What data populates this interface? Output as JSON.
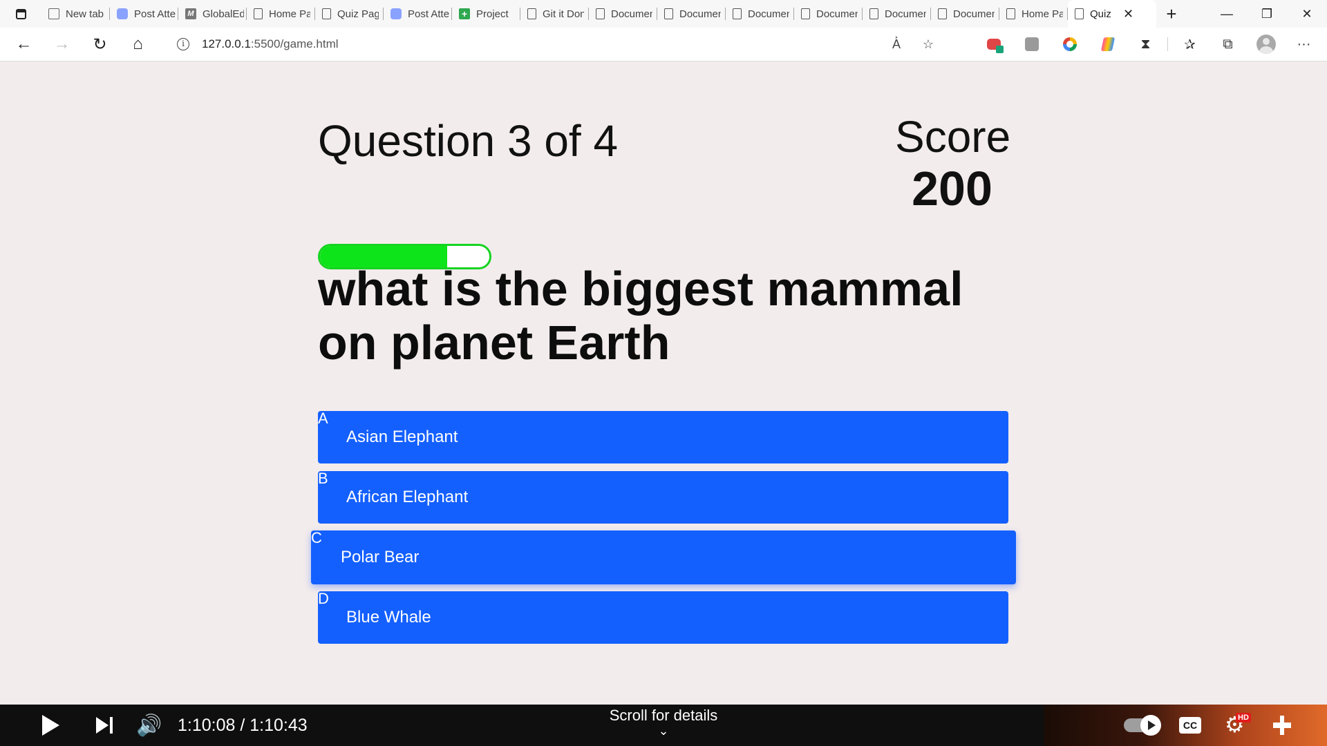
{
  "browser": {
    "tabs": [
      {
        "label": "New tab",
        "icon": "newtab-icon"
      },
      {
        "label": "Post Attendee",
        "icon": "zoom-icon"
      },
      {
        "label": "GlobalEd",
        "icon": "m-icon"
      },
      {
        "label": "Home Page",
        "icon": "doc-icon"
      },
      {
        "label": "Quiz Page",
        "icon": "doc-icon"
      },
      {
        "label": "Post Attendee",
        "icon": "zoom-icon"
      },
      {
        "label": "Project",
        "icon": "plus-icon"
      },
      {
        "label": "Git it Done",
        "icon": "doc-icon"
      },
      {
        "label": "Document",
        "icon": "doc-icon"
      },
      {
        "label": "Document",
        "icon": "doc-icon"
      },
      {
        "label": "Document",
        "icon": "doc-icon"
      },
      {
        "label": "Document",
        "icon": "doc-icon"
      },
      {
        "label": "Document",
        "icon": "doc-icon"
      },
      {
        "label": "Document",
        "icon": "doc-icon"
      },
      {
        "label": "Home Page",
        "icon": "doc-icon"
      }
    ],
    "active_tab": {
      "label": "Quiz",
      "close": "✕"
    },
    "new_tab": "+",
    "window_controls": {
      "minimize": "—",
      "restore": "❐",
      "close": "✕"
    },
    "nav": {
      "back": "←",
      "forward": "→",
      "reload": "↻",
      "home": "⌂"
    },
    "address": {
      "host": "127.0.0.1",
      "path": ":5500/game.html",
      "info": "i"
    },
    "address_icons": {
      "read_aloud": "A͐",
      "favorite_add": "☆"
    },
    "toolbar_icons": {
      "favorites": "✰",
      "collections": "⧉",
      "extensions": "⧗",
      "more": "···"
    }
  },
  "game": {
    "progress_text": "Question 3 of 4",
    "progress_fraction": 0.75,
    "score_label": "Score",
    "score_value": "200",
    "question": "what is the biggest mammal on planet Earth",
    "choices": [
      {
        "prefix": "A",
        "text": "Asian Elephant"
      },
      {
        "prefix": "B",
        "text": "African Elephant"
      },
      {
        "prefix": "C",
        "text": "Polar Bear"
      },
      {
        "prefix": "D",
        "text": "Blue Whale"
      }
    ],
    "colors": {
      "choice_bg": "#1460ff",
      "progress_fill": "#0ee41a",
      "page_bg": "#f3ecec"
    }
  },
  "player": {
    "time": "1:10:08 / 1:10:43",
    "scroll_hint": "Scroll for details",
    "chevron": "⌄",
    "volume": "🔊",
    "cc": "CC",
    "gear": "⚙",
    "hd": "HD"
  }
}
